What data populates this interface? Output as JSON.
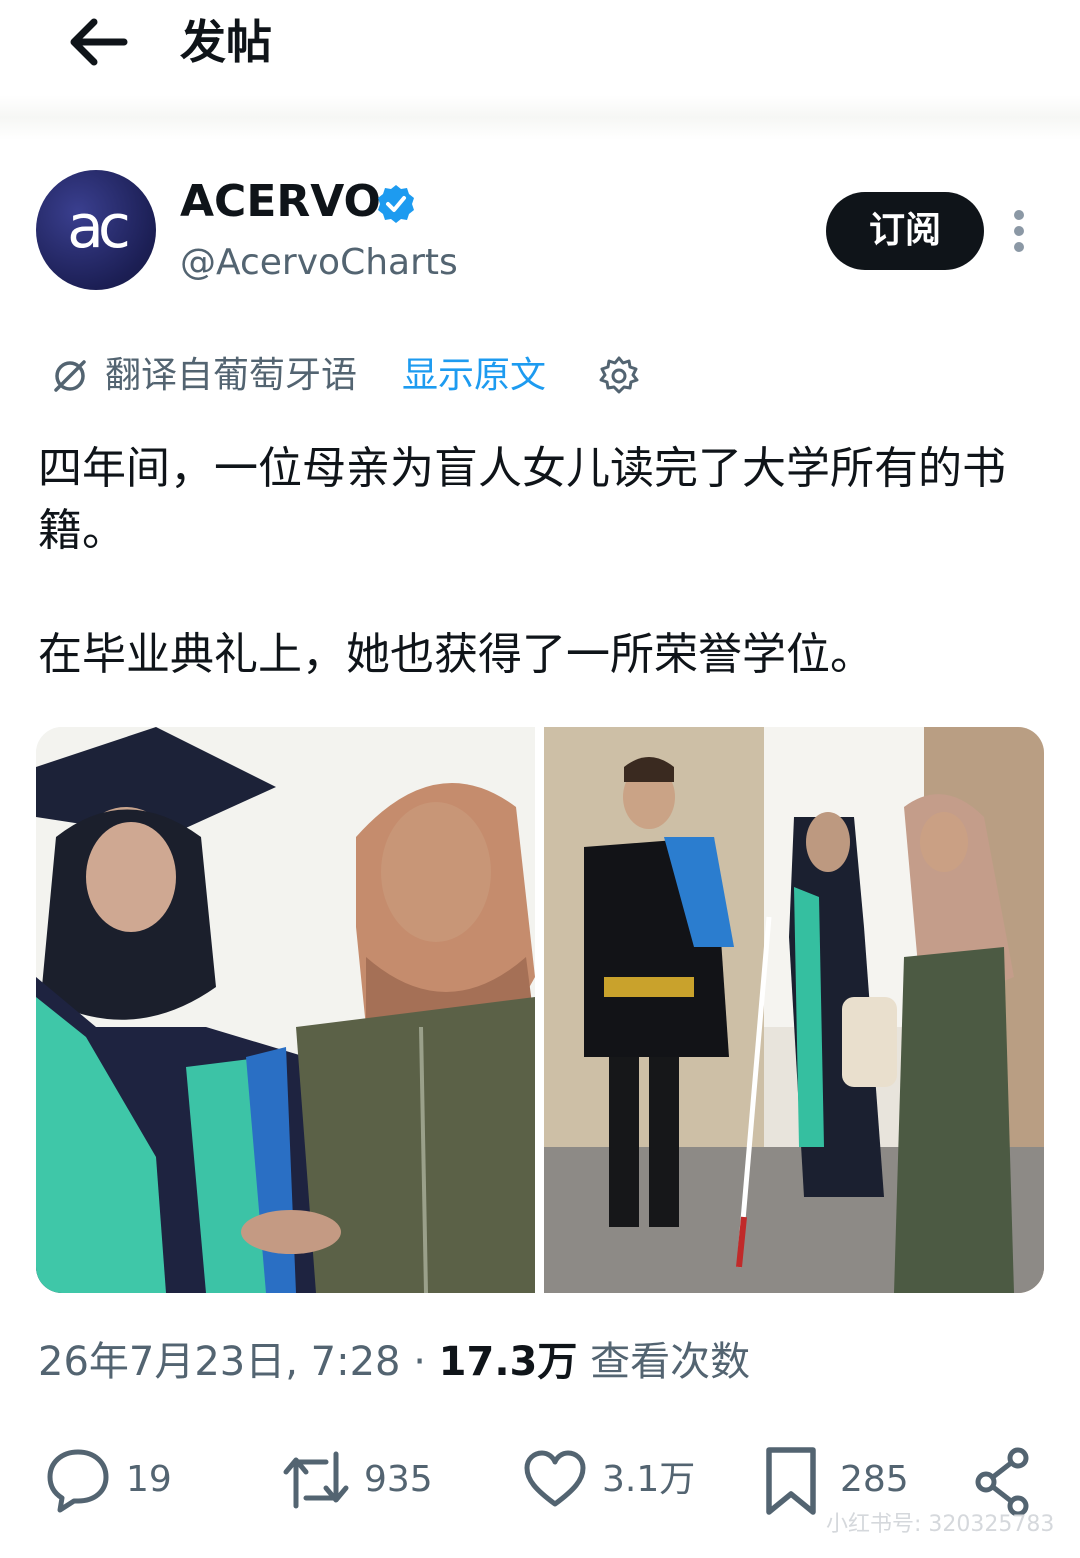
{
  "header": {
    "title": "发帖"
  },
  "author": {
    "avatar_text": "ac",
    "name": "ACERVO",
    "handle": "@AcervoCharts",
    "subscribe_label": "订阅"
  },
  "translation": {
    "label": "翻译自葡萄牙语",
    "show_original": "显示原文"
  },
  "post": {
    "paragraph_1": "四年间，一位母亲为盲人女儿读完了大学所有的书籍。",
    "paragraph_2": "在毕业典礼上，她也获得了一所荣誉学位。"
  },
  "meta": {
    "date": "26年7月23日, 7:28 · ",
    "views_count": "17.3万",
    "views_label": " 查看次数"
  },
  "actions": {
    "replies": "19",
    "reposts": "935",
    "likes": "3.1万",
    "bookmarks": "285"
  },
  "watermark": "小红书号: 320325783",
  "colors": {
    "text": "#0f1419",
    "secondary": "#536471",
    "accent": "#1d9bf0",
    "button": "#0f1419"
  },
  "icons": [
    "back-arrow-icon",
    "verified-badge-icon",
    "more-options-icon",
    "translate-icon",
    "gear-icon",
    "reply-icon",
    "repost-icon",
    "like-icon",
    "bookmark-icon",
    "share-icon"
  ]
}
